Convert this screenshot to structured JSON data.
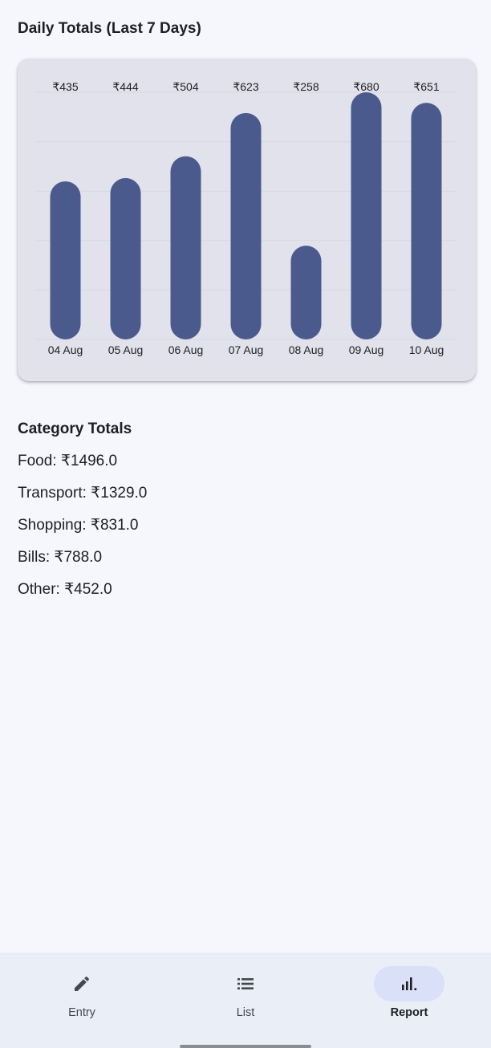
{
  "daily_section": {
    "title": "Daily Totals (Last 7 Days)"
  },
  "chart_data": {
    "type": "bar",
    "categories": [
      "04 Aug",
      "05 Aug",
      "06 Aug",
      "07 Aug",
      "08 Aug",
      "09 Aug",
      "10 Aug"
    ],
    "values": [
      435,
      444,
      504,
      623,
      258,
      680,
      651
    ],
    "value_labels": [
      "₹435",
      "₹444",
      "₹504",
      "₹623",
      "₹258",
      "₹680",
      "₹651"
    ],
    "title": "Daily Totals (Last 7 Days)",
    "xlabel": "",
    "ylabel": "",
    "ylim": [
      0,
      680
    ],
    "grid": true,
    "bar_color": "#4a5a8c"
  },
  "category_section": {
    "title": "Category Totals",
    "items": [
      "Food: ₹1496.0",
      "Transport: ₹1329.0",
      "Shopping: ₹831.0",
      "Bills: ₹788.0",
      "Other: ₹452.0"
    ]
  },
  "nav": {
    "items": [
      {
        "label": "Entry",
        "icon": "pencil-icon",
        "active": false
      },
      {
        "label": "List",
        "icon": "list-icon",
        "active": false
      },
      {
        "label": "Report",
        "icon": "bar-chart-icon",
        "active": true
      }
    ]
  },
  "colors": {
    "background": "#f5f7fc",
    "card": "#e1e2ec",
    "bar": "#4a5a8c",
    "nav_background": "#eaeef7",
    "nav_active_pill": "#d9e0f7"
  }
}
